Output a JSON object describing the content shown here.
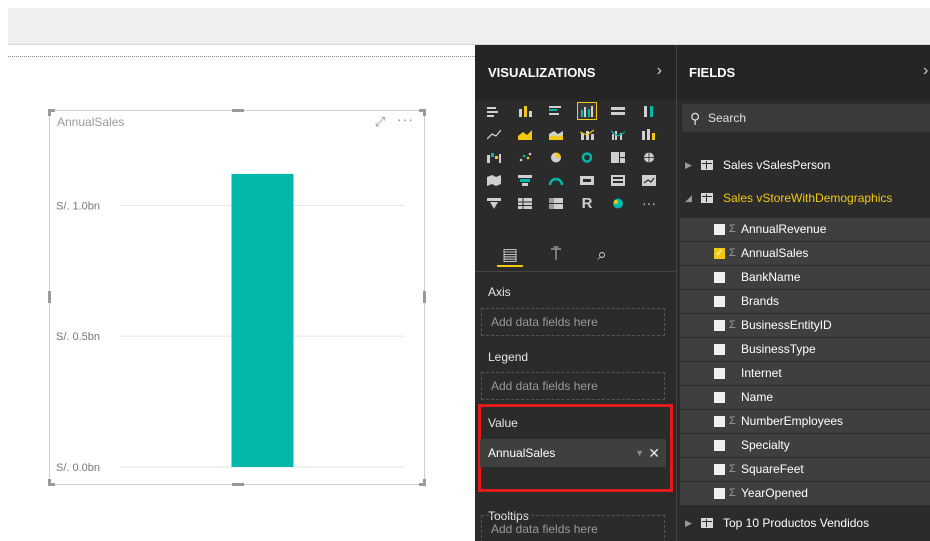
{
  "report": {
    "visual": {
      "title": "AnnualSales",
      "more_label": "···",
      "chart_data": {
        "type": "bar",
        "categories": [
          ""
        ],
        "series": [
          {
            "values": [
              1.12
            ]
          }
        ],
        "y_ticks": [
          "S/. 0.0bn",
          "S/. 0.5bn",
          "S/. 1.0bn"
        ],
        "y_tick_values": [
          0,
          0.5,
          1.0
        ],
        "ylim": [
          0,
          1.2
        ],
        "grid": true,
        "bar_color": "#01b8aa"
      }
    }
  },
  "visualizations": {
    "title": "VISUALIZATIONS",
    "more_label": "···",
    "selected_icon": "clustered-column-chart-icon",
    "r_label": "R",
    "wells": {
      "axis_label": "Axis",
      "axis_placeholder": "Add data fields here",
      "legend_label": "Legend",
      "legend_placeholder": "Add data fields here",
      "value_label": "Value",
      "value_field": "AnnualSales",
      "tooltips_label": "Tooltips",
      "tooltips_placeholder": "Add data fields here"
    }
  },
  "fields": {
    "title": "FIELDS",
    "search_placeholder": "Search",
    "tables": [
      {
        "name": "Sales vSalesPerson",
        "expanded": false
      },
      {
        "name": "Sales vStoreWithDemographics",
        "expanded": true
      },
      {
        "name": "Top 10 Productos Vendidos",
        "expanded": false
      }
    ],
    "columns": [
      {
        "name": "AnnualRevenue",
        "sigma": "Σ",
        "checked": false
      },
      {
        "name": "AnnualSales",
        "sigma": "Σ",
        "checked": true
      },
      {
        "name": "BankName",
        "sigma": "",
        "checked": false
      },
      {
        "name": "Brands",
        "sigma": "",
        "checked": false
      },
      {
        "name": "BusinessEntityID",
        "sigma": "Σ",
        "checked": false
      },
      {
        "name": "BusinessType",
        "sigma": "",
        "checked": false
      },
      {
        "name": "Internet",
        "sigma": "",
        "checked": false
      },
      {
        "name": "Name",
        "sigma": "",
        "checked": false
      },
      {
        "name": "NumberEmployees",
        "sigma": "Σ",
        "checked": false
      },
      {
        "name": "Specialty",
        "sigma": "",
        "checked": false
      },
      {
        "name": "SquareFeet",
        "sigma": "Σ",
        "checked": false
      },
      {
        "name": "YearOpened",
        "sigma": "Σ",
        "checked": false
      }
    ]
  },
  "colors": {
    "accent": "#f2c811",
    "highlight": "#e21b1b",
    "bar": "#01b8aa"
  }
}
